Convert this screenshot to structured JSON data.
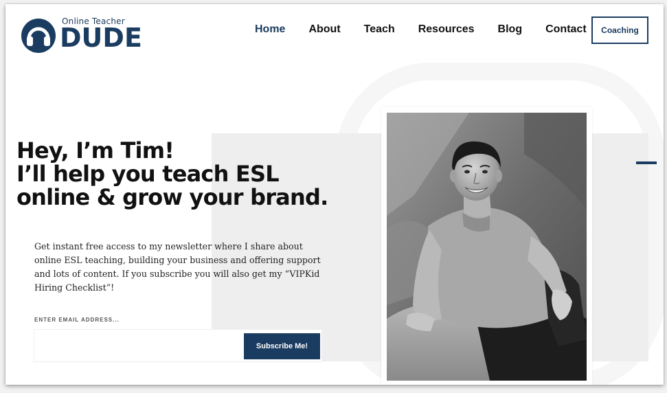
{
  "site": {
    "logo_small": "Online Teacher",
    "logo_big": "DUDE",
    "logo_icon": "headphones-icon"
  },
  "nav": {
    "items": [
      {
        "label": "Home",
        "active": true
      },
      {
        "label": "About",
        "active": false
      },
      {
        "label": "Teach",
        "active": false
      },
      {
        "label": "Resources",
        "active": false
      },
      {
        "label": "Blog",
        "active": false
      },
      {
        "label": "Contact",
        "active": false
      }
    ],
    "cta_label": "Coaching"
  },
  "hero": {
    "headline_line1": "Hey, I’m Tim!",
    "headline_line2": "I’ll help you teach ESL",
    "headline_line3": "online & grow your brand.",
    "intro": "Get instant free access to my newsletter where I share about online ESL teaching, building your business and offering support and lots of content. If you subscribe you will also get my “VIPKid Hiring Checklist”!",
    "email_label": "ENTER EMAIL ADDRESS...",
    "email_value": "",
    "subscribe_label": "Subscribe Me!"
  },
  "colors": {
    "brand_navy": "#1b3c61",
    "panel_gray": "#eeeeee",
    "text_dark": "#111111"
  }
}
